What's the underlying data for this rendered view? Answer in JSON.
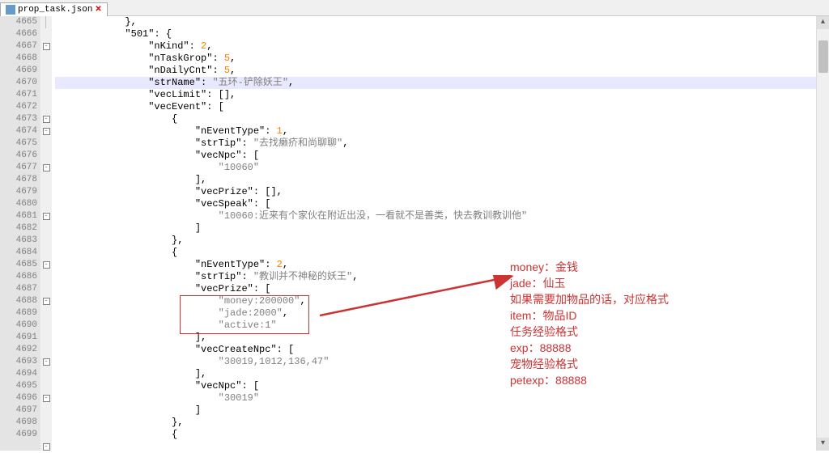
{
  "tab": {
    "filename": "prop_task.json"
  },
  "line_start": 4665,
  "line_end": 4699,
  "highlighted_line": 4670,
  "code_lines": [
    {
      "n": 4665,
      "indent": 12,
      "text": "},",
      "fold": ""
    },
    {
      "n": 4666,
      "indent": 12,
      "text": "\"501\": {",
      "fold": "-",
      "key": "501"
    },
    {
      "n": 4667,
      "indent": 16,
      "text": "\"nKind\": 2,",
      "key": "nKind",
      "val": "2",
      "t": "num"
    },
    {
      "n": 4668,
      "indent": 16,
      "text": "\"nTaskGrop\": 5,",
      "key": "nTaskGrop",
      "val": "5",
      "t": "num"
    },
    {
      "n": 4669,
      "indent": 16,
      "text": "\"nDailyCnt\": 5,",
      "key": "nDailyCnt",
      "val": "5",
      "t": "num"
    },
    {
      "n": 4670,
      "indent": 16,
      "text": "\"strName\": \"五环-铲除妖王\",",
      "key": "strName",
      "val": "五环-铲除妖王",
      "t": "str",
      "hl": true
    },
    {
      "n": 4671,
      "indent": 16,
      "text": "\"vecLimit\": [],",
      "key": "vecLimit"
    },
    {
      "n": 4672,
      "indent": 16,
      "text": "\"vecEvent\": [",
      "key": "vecEvent",
      "fold": "-"
    },
    {
      "n": 4673,
      "indent": 20,
      "text": "{",
      "fold": "-"
    },
    {
      "n": 4674,
      "indent": 24,
      "text": "\"nEventType\": 1,",
      "key": "nEventType",
      "val": "1",
      "t": "num"
    },
    {
      "n": 4675,
      "indent": 24,
      "text": "\"strTip\": \"去找癞疥和尚聊聊\",",
      "key": "strTip",
      "val": "去找癞疥和尚聊聊",
      "t": "str"
    },
    {
      "n": 4676,
      "indent": 24,
      "text": "\"vecNpc\": [",
      "key": "vecNpc",
      "fold": "-"
    },
    {
      "n": 4677,
      "indent": 28,
      "text": "\"10060\"",
      "val": "10060",
      "t": "str"
    },
    {
      "n": 4678,
      "indent": 24,
      "text": "],"
    },
    {
      "n": 4679,
      "indent": 24,
      "text": "\"vecPrize\": [],",
      "key": "vecPrize"
    },
    {
      "n": 4680,
      "indent": 24,
      "text": "\"vecSpeak\": [",
      "key": "vecSpeak",
      "fold": "-"
    },
    {
      "n": 4681,
      "indent": 28,
      "text": "\"10060:近来有个家伙在附近出没，一看就不是善类，快去教训教训他\"",
      "val": "10060:近来有个家伙在附近出没，一看就不是善类，快去教训教训他",
      "t": "str"
    },
    {
      "n": 4682,
      "indent": 24,
      "text": "]"
    },
    {
      "n": 4683,
      "indent": 20,
      "text": "},"
    },
    {
      "n": 4684,
      "indent": 20,
      "text": "{",
      "fold": "-"
    },
    {
      "n": 4685,
      "indent": 24,
      "text": "\"nEventType\": 2,",
      "key": "nEventType",
      "val": "2",
      "t": "num"
    },
    {
      "n": 4686,
      "indent": 24,
      "text": "\"strTip\": \"教训并不神秘的妖王\",",
      "key": "strTip",
      "val": "教训并不神秘的妖王",
      "t": "str"
    },
    {
      "n": 4687,
      "indent": 24,
      "text": "\"vecPrize\": [",
      "key": "vecPrize",
      "fold": "-"
    },
    {
      "n": 4688,
      "indent": 28,
      "text": "\"money:200000\",",
      "val": "money:200000",
      "t": "str"
    },
    {
      "n": 4689,
      "indent": 28,
      "text": "\"jade:2000\",",
      "val": "jade:2000",
      "t": "str"
    },
    {
      "n": 4690,
      "indent": 28,
      "text": "\"active:1\"",
      "val": "active:1",
      "t": "str"
    },
    {
      "n": 4691,
      "indent": 24,
      "text": "],"
    },
    {
      "n": 4692,
      "indent": 24,
      "text": "\"vecCreateNpc\": [",
      "key": "vecCreateNpc",
      "fold": "-"
    },
    {
      "n": 4693,
      "indent": 28,
      "text": "\"30019,1012,136,47\"",
      "val": "30019,1012,136,47",
      "t": "str"
    },
    {
      "n": 4694,
      "indent": 24,
      "text": "],"
    },
    {
      "n": 4695,
      "indent": 24,
      "text": "\"vecNpc\": [",
      "key": "vecNpc",
      "fold": "-"
    },
    {
      "n": 4696,
      "indent": 28,
      "text": "\"30019\"",
      "val": "30019",
      "t": "str"
    },
    {
      "n": 4697,
      "indent": 24,
      "text": "]"
    },
    {
      "n": 4698,
      "indent": 20,
      "text": "},"
    },
    {
      "n": 4699,
      "indent": 20,
      "text": "{",
      "fold": "-"
    }
  ],
  "annotation": {
    "lines": [
      "money：金钱",
      "jade：仙玉",
      "如果需要加物品的话，对应格式",
      "item：物品ID",
      "任务经验格式",
      "exp：88888",
      "宠物经验格式",
      "petexp：88888"
    ]
  }
}
